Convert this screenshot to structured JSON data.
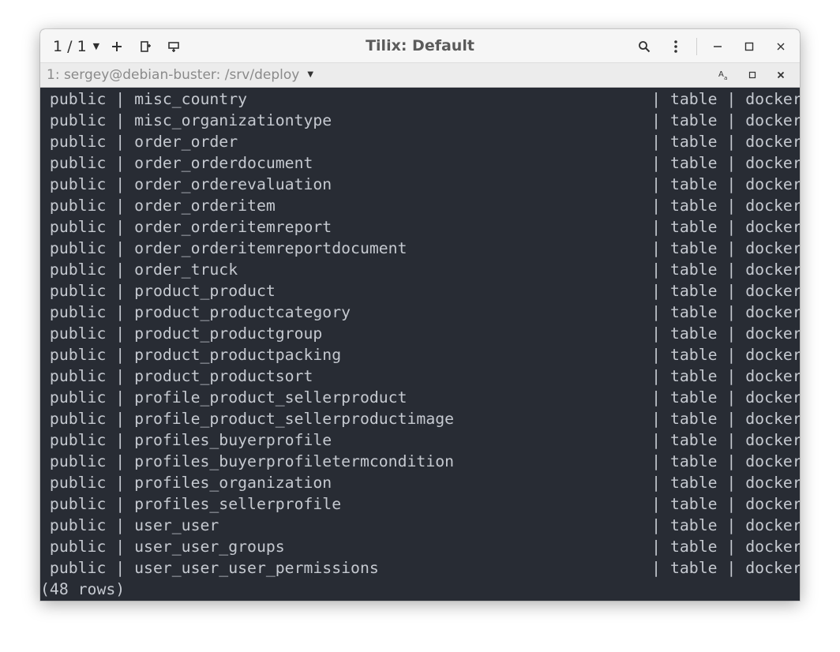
{
  "titlebar": {
    "session_selector": "1 / 1",
    "title": "Tilix: Default",
    "icons": {
      "session_caret": "chevron-down-icon",
      "add": "plus-icon",
      "split_right": "split-vertical-icon",
      "split_down": "split-horizontal-icon",
      "search": "search-icon",
      "menu": "kebab-menu-icon",
      "minimize": "minimize-icon",
      "maximize": "maximize-icon",
      "close": "close-icon"
    }
  },
  "terminal_bar": {
    "title": "1: sergey@debian-buster: /srv/deploy",
    "icons": {
      "title_caret": "chevron-down-icon",
      "read_only": "text-size-icon",
      "maximize": "maximize-icon",
      "close": "close-icon"
    }
  },
  "terminal": {
    "rows": [
      {
        "schema": "public",
        "name": "misc_country",
        "type": "table",
        "owner": "docker"
      },
      {
        "schema": "public",
        "name": "misc_organizationtype",
        "type": "table",
        "owner": "docker"
      },
      {
        "schema": "public",
        "name": "order_order",
        "type": "table",
        "owner": "docker"
      },
      {
        "schema": "public",
        "name": "order_orderdocument",
        "type": "table",
        "owner": "docker"
      },
      {
        "schema": "public",
        "name": "order_orderevaluation",
        "type": "table",
        "owner": "docker"
      },
      {
        "schema": "public",
        "name": "order_orderitem",
        "type": "table",
        "owner": "docker"
      },
      {
        "schema": "public",
        "name": "order_orderitemreport",
        "type": "table",
        "owner": "docker"
      },
      {
        "schema": "public",
        "name": "order_orderitemreportdocument",
        "type": "table",
        "owner": "docker"
      },
      {
        "schema": "public",
        "name": "order_truck",
        "type": "table",
        "owner": "docker"
      },
      {
        "schema": "public",
        "name": "product_product",
        "type": "table",
        "owner": "docker"
      },
      {
        "schema": "public",
        "name": "product_productcategory",
        "type": "table",
        "owner": "docker"
      },
      {
        "schema": "public",
        "name": "product_productgroup",
        "type": "table",
        "owner": "docker"
      },
      {
        "schema": "public",
        "name": "product_productpacking",
        "type": "table",
        "owner": "docker"
      },
      {
        "schema": "public",
        "name": "product_productsort",
        "type": "table",
        "owner": "docker"
      },
      {
        "schema": "public",
        "name": "profile_product_sellerproduct",
        "type": "table",
        "owner": "docker"
      },
      {
        "schema": "public",
        "name": "profile_product_sellerproductimage",
        "type": "table",
        "owner": "docker"
      },
      {
        "schema": "public",
        "name": "profiles_buyerprofile",
        "type": "table",
        "owner": "docker"
      },
      {
        "schema": "public",
        "name": "profiles_buyerprofiletermcondition",
        "type": "table",
        "owner": "docker"
      },
      {
        "schema": "public",
        "name": "profiles_organization",
        "type": "table",
        "owner": "docker"
      },
      {
        "schema": "public",
        "name": "profiles_sellerprofile",
        "type": "table",
        "owner": "docker"
      },
      {
        "schema": "public",
        "name": "user_user",
        "type": "table",
        "owner": "docker"
      },
      {
        "schema": "public",
        "name": "user_user_groups",
        "type": "table",
        "owner": "docker"
      },
      {
        "schema": "public",
        "name": "user_user_user_permissions",
        "type": "table",
        "owner": "docker"
      }
    ],
    "footer": "(48 rows)"
  },
  "colors": {
    "terminal_bg": "#282c34",
    "terminal_fg": "#c5c9d0",
    "titlebar_bg": "#f6f6f6"
  }
}
